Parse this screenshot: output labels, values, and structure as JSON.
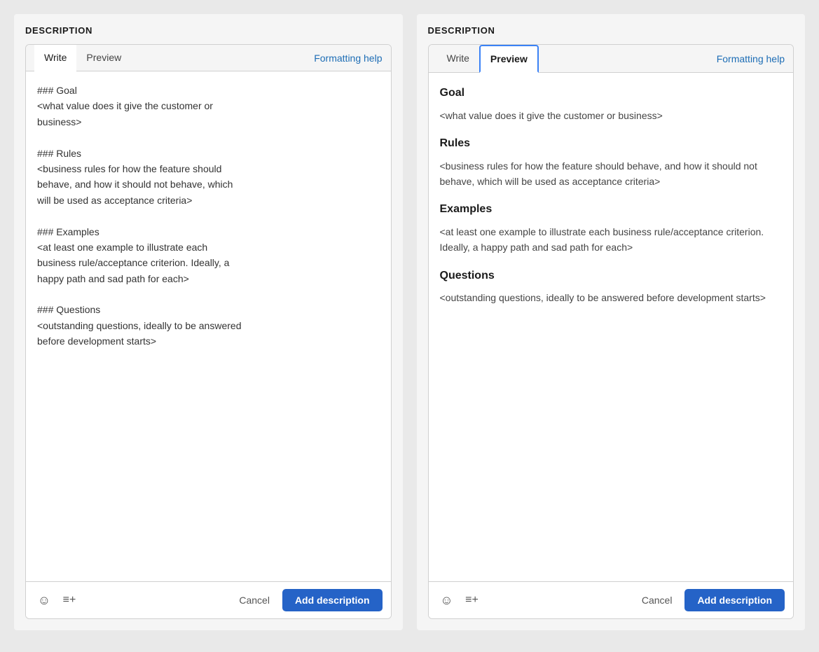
{
  "left_panel": {
    "section_label": "DESCRIPTION",
    "tabs": [
      {
        "id": "write",
        "label": "Write",
        "active": true
      },
      {
        "id": "preview",
        "label": "Preview",
        "active": false
      }
    ],
    "formatting_help_label": "Formatting help",
    "editor_text": "### Goal\n<what value does it give the customer or\nbusiness>\n\n### Rules\n<business rules for how the feature should\nbehave, and how it should not behave, which\nwill be used as acceptance criteria>\n\n### Examples\n<at least one example to illustrate each\nbusiness rule/acceptance criterion. Ideally, a\nhappy path and sad path for each>\n\n### Questions\n<outstanding questions, ideally to be answered\nbefore development starts>",
    "footer": {
      "cancel_label": "Cancel",
      "add_label": "Add description"
    }
  },
  "right_panel": {
    "section_label": "DESCRIPTION",
    "tabs": [
      {
        "id": "write",
        "label": "Write",
        "active": false
      },
      {
        "id": "preview",
        "label": "Preview",
        "active": true
      }
    ],
    "formatting_help_label": "Formatting help",
    "preview": {
      "sections": [
        {
          "heading": "Goal",
          "body": "<what value does it give the customer or business>"
        },
        {
          "heading": "Rules",
          "body": "<business rules for how the feature should behave, and how it should not behave, which will be used as acceptance criteria>"
        },
        {
          "heading": "Examples",
          "body": "<at least one example to illustrate each business rule/acceptance criterion. Ideally, a happy path and sad path for each>"
        },
        {
          "heading": "Questions",
          "body": "<outstanding questions, ideally to be answered before development starts>"
        }
      ]
    },
    "footer": {
      "cancel_label": "Cancel",
      "add_label": "Add description"
    }
  }
}
